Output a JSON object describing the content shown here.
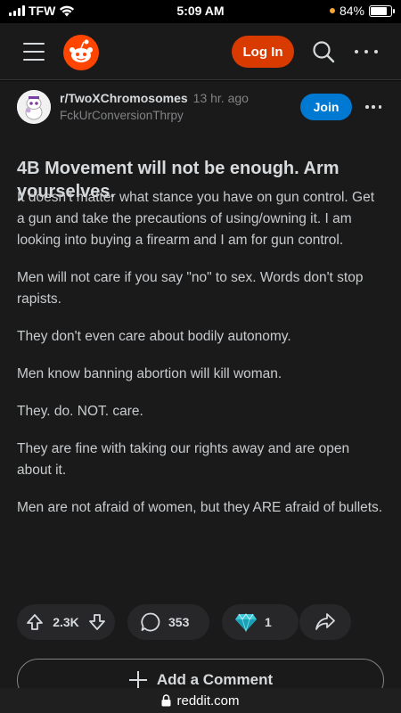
{
  "status_bar": {
    "carrier": "TFW",
    "time": "5:09 AM",
    "battery": "84%",
    "battery_level": 0.84,
    "indicator_color": "#f6a43b"
  },
  "header": {
    "login_label": "Log In",
    "icons": [
      "menu-icon",
      "reddit-logo",
      "search-icon",
      "more-icon"
    ],
    "login_color": "#d93a00"
  },
  "post": {
    "subreddit": "r/TwoXChromosomes",
    "time_ago": "13 hr. ago",
    "author": "FckUrConversionThrpy",
    "join_label": "Join",
    "join_color": "#0079d3",
    "title": "4B Movement will not be enough. Arm yourselves.",
    "paragraphs": [
      "It doesn't matter what stance you have on gun control. Get a gun and take the precautions of using/owning it. I am looking into buying a firearm and I am for gun control.",
      "Men will not care if you say \"no\" to sex. Words don't stop rapists.",
      "They don't even care about bodily autonomy.",
      "Men know banning abortion will kill woman.",
      "They. do. NOT. care.",
      "They are fine with taking our rights away and are open about it.",
      "Men are not afraid of women, but they ARE afraid of bullets."
    ]
  },
  "actions": {
    "votes": "2.3K",
    "comments": "353",
    "awards": "1",
    "icons": [
      "upvote-icon",
      "downvote-icon",
      "comment-icon",
      "award-icon",
      "share-icon"
    ]
  },
  "add_comment_label": "Add a Comment",
  "browser": {
    "url": "reddit.com"
  }
}
